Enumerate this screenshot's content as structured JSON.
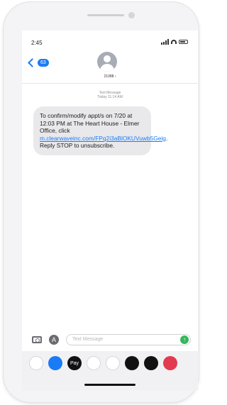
{
  "status_bar": {
    "time": "2:45"
  },
  "header": {
    "back_badge": "63",
    "contact_name": "21088 ›"
  },
  "conversation": {
    "meta_title": "Text Message",
    "meta_time": "Today 11:14 AM",
    "message_before_link": "To confirm/modify appt/s on 7/20 at 12:03 PM at The Heart House - Elmer Office, click ",
    "message_link": "m.clearwaveinc.com/FPq2i3aBlOKUVuwb5Geig",
    "message_after_link": ". Reply STOP to unsubscribe."
  },
  "input_bar": {
    "placeholder": "Text Message",
    "send_symbol": "↑"
  },
  "app_drawer": {
    "apps": [
      {
        "name": "photos-app-icon",
        "color": "#ffffff"
      },
      {
        "name": "app-store-app-icon",
        "color": "#1a7cf5"
      },
      {
        "name": "apple-pay-app-icon",
        "color": "#111111",
        "label": "Pay"
      },
      {
        "name": "memoji-app-icon",
        "color": "#ffffff"
      },
      {
        "name": "animoji-app-icon",
        "color": "#ffffff"
      },
      {
        "name": "digital-touch-app-icon",
        "color": "#111111"
      },
      {
        "name": "music-app-icon",
        "color": "#111111"
      },
      {
        "name": "search-images-app-icon",
        "color": "#e23a4e"
      }
    ]
  }
}
